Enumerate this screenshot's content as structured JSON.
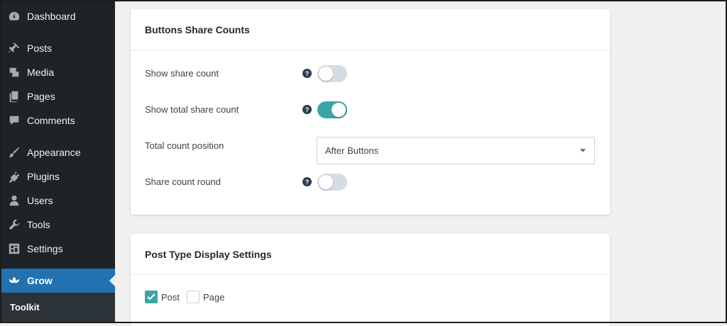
{
  "sidebar": {
    "items": [
      {
        "label": "Dashboard",
        "icon": "dashboard-icon"
      },
      {
        "label": "Posts",
        "icon": "pin-icon"
      },
      {
        "label": "Media",
        "icon": "media-icon"
      },
      {
        "label": "Pages",
        "icon": "pages-icon"
      },
      {
        "label": "Comments",
        "icon": "comment-icon"
      },
      {
        "label": "Appearance",
        "icon": "brush-icon"
      },
      {
        "label": "Plugins",
        "icon": "plugin-icon"
      },
      {
        "label": "Users",
        "icon": "user-icon"
      },
      {
        "label": "Tools",
        "icon": "wrench-icon"
      },
      {
        "label": "Settings",
        "icon": "settings-icon"
      },
      {
        "label": "Grow",
        "icon": "grow-lotus-icon",
        "active": true
      }
    ],
    "submenu": {
      "label": "Toolkit"
    }
  },
  "share_counts": {
    "title": "Buttons Share Counts",
    "rows": [
      {
        "label": "Show share count",
        "help": "?",
        "enabled": false
      },
      {
        "label": "Show total share count",
        "help": "?",
        "enabled": true
      },
      {
        "label": "Total count position",
        "select_value": "After Buttons"
      },
      {
        "label": "Share count round",
        "help": "?",
        "enabled": false
      }
    ]
  },
  "post_type": {
    "title": "Post Type Display Settings",
    "options": [
      {
        "label": "Post",
        "checked": true
      },
      {
        "label": "Page",
        "checked": false
      }
    ]
  },
  "colors": {
    "sidebar_bg": "#1d2327",
    "active_bg": "#2271b1",
    "toggle_on": "#3aa5a8",
    "toggle_off": "#d5dce2",
    "help_icon": "#2c3e50"
  }
}
